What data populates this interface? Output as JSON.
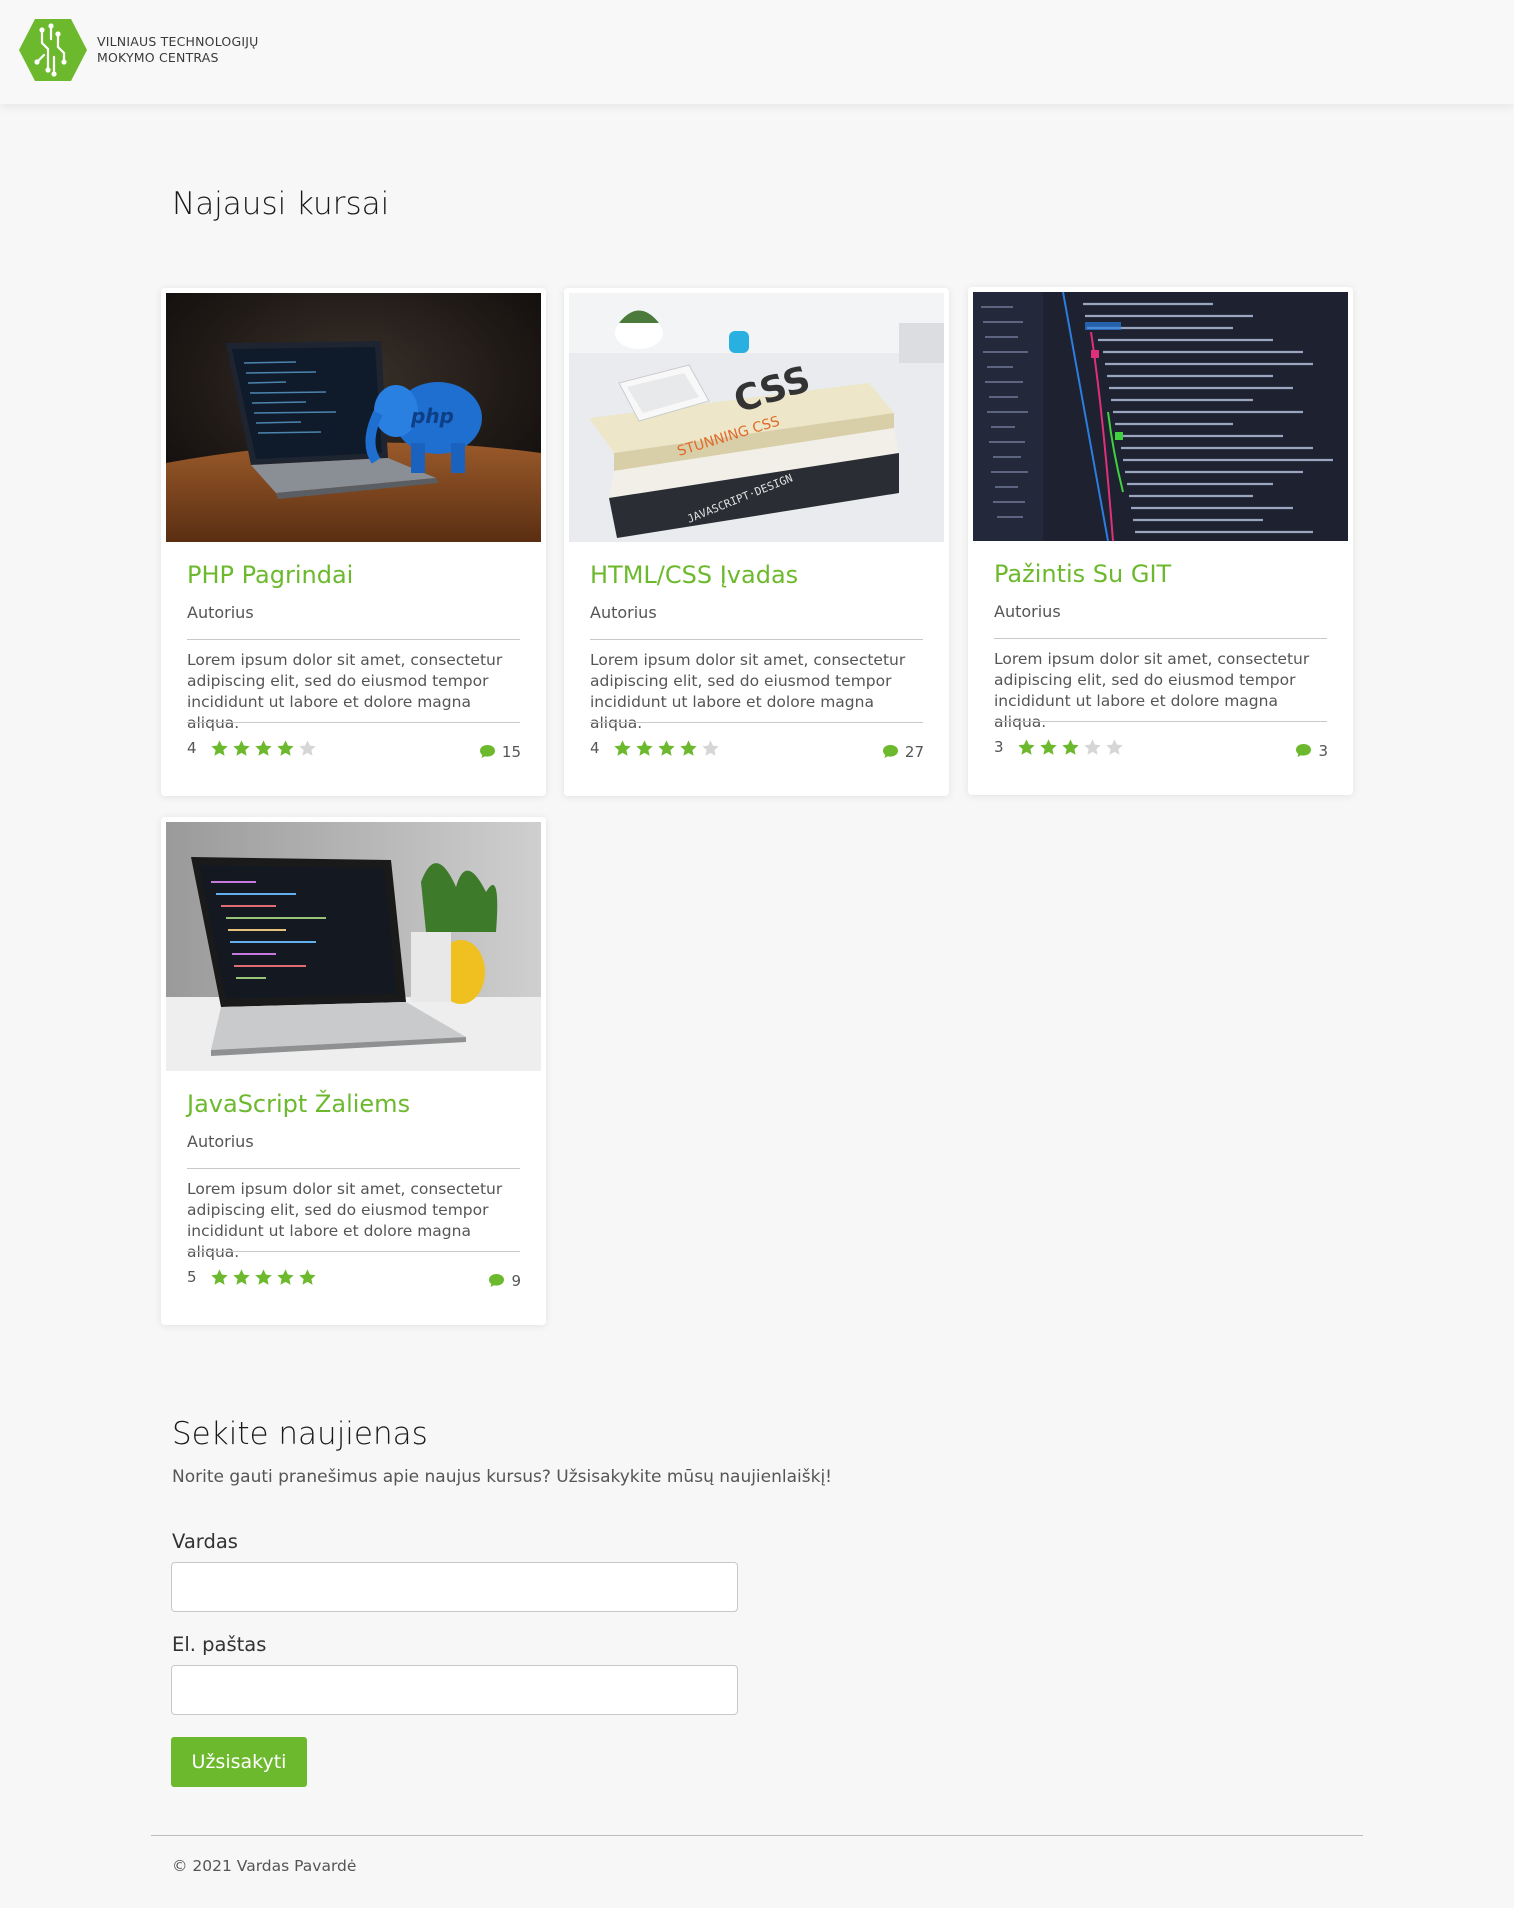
{
  "header": {
    "brand_line1": "VILNIAUS TECHNOLOGIJŲ",
    "brand_line2": "MOKYMO CENTRAS",
    "brand_color": "#6cb92e"
  },
  "courses_section": {
    "title": "Najausi kursai"
  },
  "courses": [
    {
      "title": "PHP Pagrindai",
      "author": "Autorius",
      "description": "Lorem ipsum dolor sit amet, consectetur adipiscing elit, sed do eiusmod tempor incididunt ut labore et dolore magna aliqua.",
      "rating": 4,
      "rating_label": "4",
      "comments": "15",
      "image": "laptop-php-elephant"
    },
    {
      "title": "HTML/CSS Įvadas",
      "author": "Autorius",
      "description": "Lorem ipsum dolor sit amet, consectetur adipiscing elit, sed do eiusmod tempor incididunt ut labore et dolore magna aliqua.",
      "rating": 4,
      "rating_label": "4",
      "comments": "27",
      "image": "css-books-phone"
    },
    {
      "title": "Pažintis Su GIT",
      "author": "Autorius",
      "description": "Lorem ipsum dolor sit amet, consectetur adipiscing elit, sed do eiusmod tempor incididunt ut labore et dolore magna aliqua.",
      "rating": 3,
      "rating_label": "3",
      "comments": "3",
      "image": "git-log-screen"
    },
    {
      "title": "JavaScript Žaliems",
      "author": "Autorius",
      "description": "Lorem ipsum dolor sit amet, consectetur adipiscing elit, sed do eiusmod tempor incididunt ut labore et dolore magna aliqua.",
      "rating": 5,
      "rating_label": "5",
      "comments": "9",
      "image": "laptop-code-plant"
    }
  ],
  "newsletter": {
    "title": "Sekite naujienas",
    "subtitle": "Norite gauti pranešimus apie naujus kursus? Užsisakykite mūsų naujienlaiškį!",
    "name_label": "Vardas",
    "name_value": "",
    "email_label": "El. paštas",
    "email_value": "",
    "button_label": "Užsisakyti"
  },
  "footer": {
    "text": "© 2021 Vardas Pavardė"
  },
  "colors": {
    "accent": "#6cb92e",
    "star_on": "#6cb92e",
    "star_off": "#d6d6d6",
    "background": "#f7f7f7"
  }
}
